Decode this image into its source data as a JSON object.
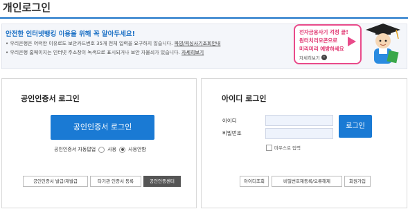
{
  "page": {
    "title": "개인로그인"
  },
  "notice": {
    "heading": "안전한 인터넷뱅킹 이용을 위해 꼭 알아두세요!",
    "lines": [
      {
        "text": "• 우리은행은 어떠한 이유로도 보안카드번호 35개 전체 입력을 요구하지 않습니다.",
        "link": "파밍/피싱사기조회안내"
      },
      {
        "text": "• 우리은행 홈페이지는 인터넷 주소창이 녹색으로 표시되거나 보안 자물쇠가 있습니다.",
        "link": "자세히보기"
      }
    ]
  },
  "promo": {
    "lines": [
      "전자금융사기 걱정 끝!",
      "원터치리모콘으로",
      "미리미리 예방하세요"
    ],
    "more_label": "자세히보기"
  },
  "cert_login": {
    "title": "공인인증서 로그인",
    "login_button": "공인인증서 로그인",
    "auto_login_label": "공인인증서 자동팝업",
    "options": [
      {
        "label": "사용",
        "selected": false
      },
      {
        "label": "사용안함",
        "selected": true
      }
    ],
    "buttons": [
      "공인인증서 발급/재발급",
      "타기관 인증서 등록",
      "공인인증센터"
    ]
  },
  "id_login": {
    "title": "아이디 로그인",
    "id_label": "아이디",
    "password_label": "비밀번호",
    "login_button": "로그인",
    "remember_label": "마우스로 입력",
    "buttons": [
      "아이디조회",
      "비밀번호재등록/오류해제",
      "회원가입"
    ]
  },
  "colors": {
    "accent": "#1a7ad4",
    "promo": "#e94a8a"
  }
}
